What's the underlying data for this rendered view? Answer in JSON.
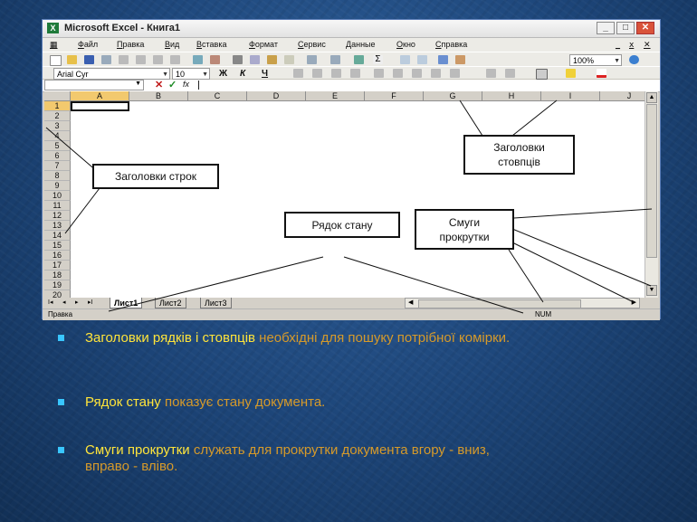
{
  "window": {
    "title": "Microsoft Excel - Книга1",
    "logo": "X",
    "buttons": {
      "minimize": "_",
      "maximize": "□",
      "close": "✕"
    }
  },
  "menu": {
    "items": [
      "Файл",
      "Правка",
      "Вид",
      "Вставка",
      "Формат",
      "Сервис",
      "Данные",
      "Окно",
      "Справка"
    ],
    "right_controls": [
      "_",
      "ⅹ",
      "✕"
    ]
  },
  "toolbar": {
    "zoom": "100%",
    "font": "Arial Cyr",
    "font_size": "10",
    "bold": "Ж",
    "italic": "К",
    "underline": "Ч"
  },
  "formula_bar": {
    "cancel": "✕",
    "ok": "✓",
    "fx": "fx"
  },
  "sheet": {
    "columns": [
      "A",
      "B",
      "C",
      "D",
      "E",
      "F",
      "G",
      "H",
      "I",
      "J"
    ],
    "rows": [
      "1",
      "2",
      "3",
      "4",
      "5",
      "6",
      "7",
      "8",
      "9",
      "10",
      "11",
      "12",
      "13",
      "14",
      "15",
      "16",
      "17",
      "18",
      "19",
      "20"
    ],
    "tabs": [
      "Лист1",
      "Лист2",
      "Лист3"
    ],
    "nav": [
      "I◂",
      "◂",
      "▸",
      "▸I"
    ]
  },
  "status": {
    "left": "Правка",
    "right": "NUM"
  },
  "callouts": {
    "row_headers": "Заголовки строк",
    "col_headers_line1": "Заголовки",
    "col_headers_line2": "стовпців",
    "status_bar": "Рядок стану",
    "scrollbars_line1": "Смуги",
    "scrollbars_line2": "прокрутки"
  },
  "bullets": [
    {
      "key": "Заголовки рядків і стовпців",
      "rest": " необхідні для пошуку потрібної комірки."
    },
    {
      "key": "Рядок стану",
      "rest": " показує стану документа."
    },
    {
      "key": "Смуги прокрутки",
      "rest": " служать для прокрутки документа вгору - вниз, вправо - вліво."
    }
  ],
  "colors": {
    "background": "#1c4477",
    "bullet_key": "#ffe43a",
    "bullet_rest": "#d69a2a",
    "bullet_marker": "#39c6ff"
  }
}
